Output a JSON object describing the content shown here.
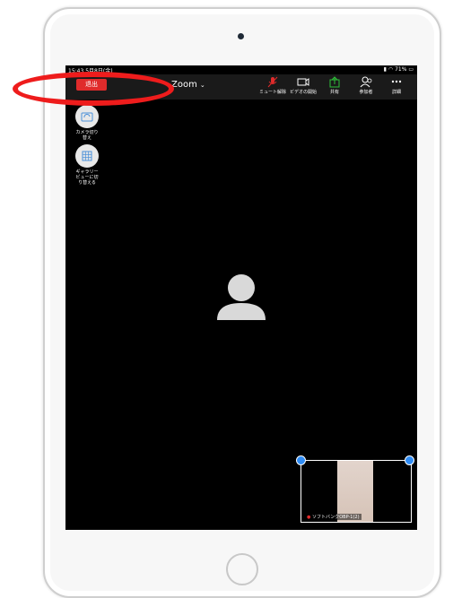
{
  "status": {
    "time": "15:43",
    "date": "5月8日(金)",
    "battery": "71%"
  },
  "toolbar": {
    "leave_label": "退出",
    "meeting_title": "Zoom",
    "mute_label": "ミュート解除",
    "video_label": "ビデオの開始",
    "share_label": "共有",
    "participants_label": "参加者",
    "more_label": "詳細"
  },
  "side": {
    "switch_camera_label": "カメラ切り替え",
    "gallery_label": "ギャラリービューに切り替える"
  },
  "thumbnail": {
    "name": "ソフトバンクOBP-1(2)"
  },
  "colors": {
    "leave": "#e02b2b",
    "annotation": "#ee1c1c",
    "mute_icon": "#e02b2b",
    "share_icon": "#2fbf3a",
    "handle": "#2f8cf5"
  }
}
